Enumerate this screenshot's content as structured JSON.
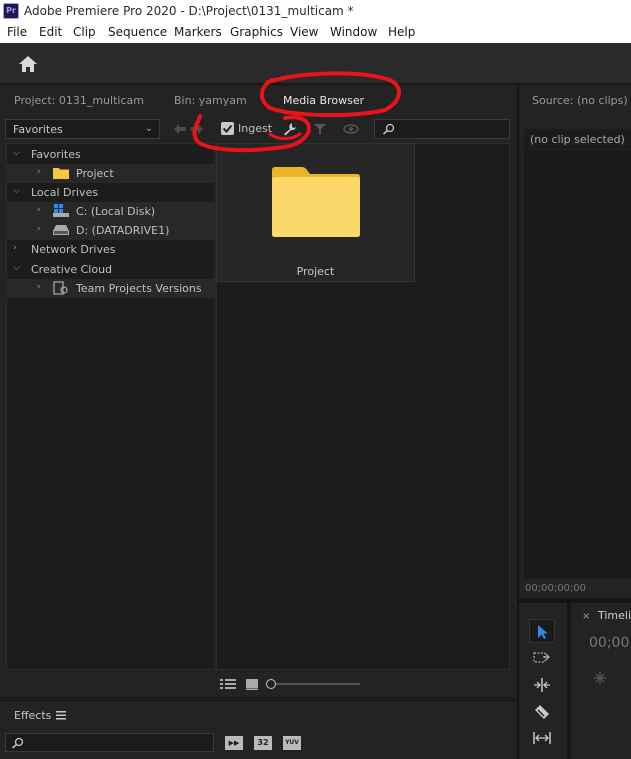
{
  "window": {
    "title": "Adobe Premiere Pro 2020 - D:\\Project\\0131_multicam *",
    "app_icon_text": "Pr"
  },
  "menu": [
    "File",
    "Edit",
    "Clip",
    "Sequence",
    "Markers",
    "Graphics",
    "View",
    "Window",
    "Help"
  ],
  "left_tabs": {
    "project": "Project: 0131_multicam",
    "bin": "Bin: yamyam",
    "media_browser": "Media Browser"
  },
  "toolbar": {
    "favorites_select": "Favorites",
    "ingest_label": "Ingest",
    "ingest_checked": true
  },
  "tree": {
    "favorites": "Favorites",
    "favorites_project": "Project",
    "local_drives": "Local Drives",
    "drive_c": "C: (Local Disk)",
    "drive_d": "D: (DATADRIVE1)",
    "network_drives": "Network Drives",
    "creative_cloud": "Creative Cloud",
    "team_projects": "Team Projects Versions"
  },
  "content": {
    "folder_label": "Project"
  },
  "source": {
    "title": "Source: (no clips)",
    "selection": "(no clip selected)",
    "timecode": "00;00;00;00"
  },
  "timeline": {
    "tab_label": "Timeli",
    "timecode": "00;00"
  },
  "effects": {
    "title": "Effects",
    "badge_32": "32",
    "badge_yuv": "YUV"
  },
  "icons": [
    "home-icon",
    "back-arrow-icon",
    "forward-arrow-icon",
    "wrench-icon",
    "filter-icon",
    "eye-icon",
    "search-icon",
    "folder-icon",
    "hard-drive-icon",
    "list-view-icon",
    "icon-view-icon",
    "zoom-slider",
    "selection-tool-icon",
    "track-select-icon",
    "ripple-edit-icon",
    "razor-icon",
    "slip-icon",
    "panel-menu-icon",
    "accelerated-effects-icon"
  ],
  "colors": {
    "accent_blue": "#2d8ceb",
    "folder_yellow": "#f5c842",
    "annotation_red": "#e8141a"
  }
}
